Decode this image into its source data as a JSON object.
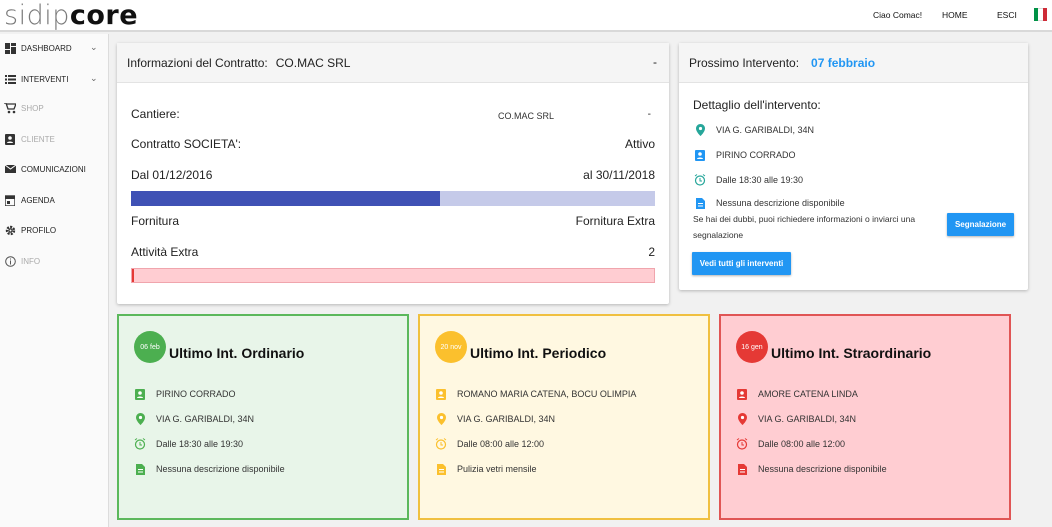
{
  "header": {
    "logo_light": "sidip",
    "logo_bold": "core",
    "greeting": "Ciao Comac!",
    "home": "HOME",
    "exit": "ESCI",
    "flag_colors": [
      "#009246",
      "#ffffff",
      "#ce2b37"
    ]
  },
  "sidebar": {
    "items": [
      {
        "label": "DASHBOARD",
        "icon": "dashboard-icon",
        "chevron": "⌄"
      },
      {
        "label": "INTERVENTI",
        "icon": "list-icon",
        "chevron": "⌄"
      },
      {
        "label": "SHOP",
        "icon": "cart-icon"
      },
      {
        "label": "CLIENTE",
        "icon": "contact-icon"
      },
      {
        "label": "COMUNICAZIONI",
        "icon": "mail-icon"
      },
      {
        "label": "AGENDA",
        "icon": "calendar-icon"
      },
      {
        "label": "PROFILO",
        "icon": "gear-icon"
      },
      {
        "label": "INFO",
        "icon": "info-icon"
      }
    ]
  },
  "contract": {
    "header_label": "Informazioni del Contratto:",
    "header_company": "CO.MAC SRL",
    "toggle": "-",
    "cantiere_label": "Cantiere:",
    "cantiere_value": "CO.MAC SRL",
    "cantiere_toggle": "-",
    "societa_label": "Contratto SOCIETA':",
    "societa_value": "Attivo",
    "date_from": "Dal 01/12/2016",
    "date_to": "al 30/11/2018",
    "progress": 0.59,
    "fornitura_label": "Fornitura",
    "fornitura_value": "Fornitura Extra",
    "attivita_label": "Attività Extra",
    "attivita_value": "2",
    "attivita_progress": 0.003
  },
  "next_intervention": {
    "label": "Prossimo Intervento:",
    "date": "07 febbraio",
    "detail_title": "Dettaglio dell'intervento:",
    "address": "VIA G. GARIBALDI, 34N",
    "person": "PIRINO CORRADO",
    "time": "Dalle 18:30 alle 19:30",
    "description": "Nessuna descrizione disponibile",
    "help_text_1": "Se hai dei dubbi, puoi richiedere informazioni o inviarci una",
    "help_text_2": "segnalazione",
    "report_button": "Segnalazione",
    "all_button": "Vedi tutti gli interventi"
  },
  "last": [
    {
      "badge": "06 feb",
      "title": "Ultimo Int. Ordinario",
      "person": "PIRINO CORRADO",
      "address": "VIA G. GARIBALDI, 34N",
      "time": "Dalle 18:30 alle 19:30",
      "description": "Nessuna descrizione disponibile",
      "accent": "#4caf50",
      "bg": "#e8f5e9",
      "border": "#5cb85c"
    },
    {
      "badge": "20 nov",
      "title": "Ultimo Int. Periodico",
      "person": "ROMANO MARIA CATENA, BOCU OLIMPIA",
      "address": "VIA G. GARIBALDI, 34N",
      "time": "Dalle 08:00 alle 12:00",
      "description": "Pulizia vetri mensile",
      "accent": "#fbc02d",
      "bg": "#fff8e1",
      "border": "#f0c040"
    },
    {
      "badge": "16 gen",
      "title": "Ultimo Int. Straordinario",
      "person": "AMORE CATENA LINDA",
      "address": "VIA G. GARIBALDI, 34N",
      "time": "Dalle 08:00 alle 12:00",
      "description": "Nessuna descrizione disponibile",
      "accent": "#e53935",
      "bg": "#ffcdd2",
      "border": "#e05555"
    }
  ]
}
